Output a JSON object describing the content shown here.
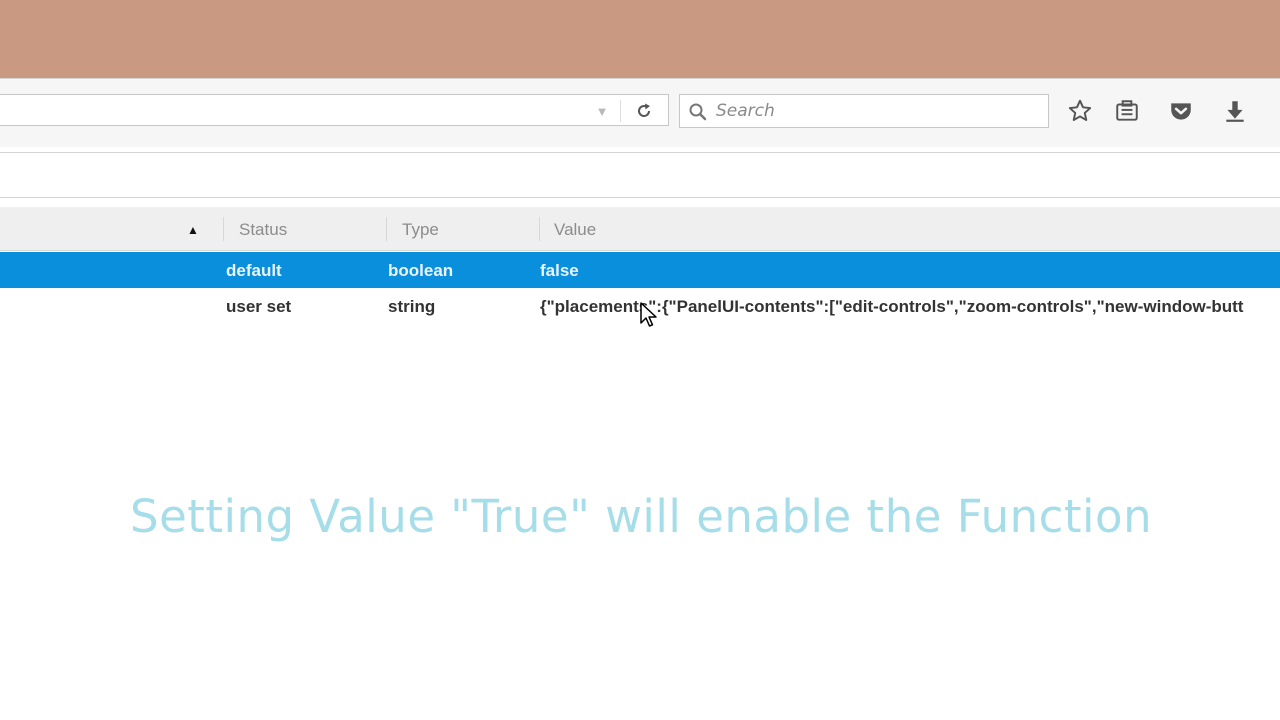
{
  "toolbar": {
    "search": {
      "placeholder": "Search"
    },
    "icons": [
      "dropdown-arrow-icon",
      "reload-icon",
      "search-icon",
      "star-icon",
      "reading-list-icon",
      "pocket-icon",
      "download-icon"
    ]
  },
  "table": {
    "columns": [
      "Status",
      "Type",
      "Value"
    ],
    "sort_indicator": "▲",
    "rows": [
      {
        "status": "default",
        "type": "boolean",
        "value": "false",
        "selected": true
      },
      {
        "status": "user set",
        "type": "string",
        "value": "{\"placements\":{\"PanelUI-contents\":[\"edit-controls\",\"zoom-controls\",\"new-window-butt",
        "selected": false
      }
    ]
  },
  "caption": "Setting Value \"True\" will enable the Function",
  "colors": {
    "titlebar": "#c99a81",
    "selection": "#0a8fdc",
    "caption": "#a5dde9"
  }
}
